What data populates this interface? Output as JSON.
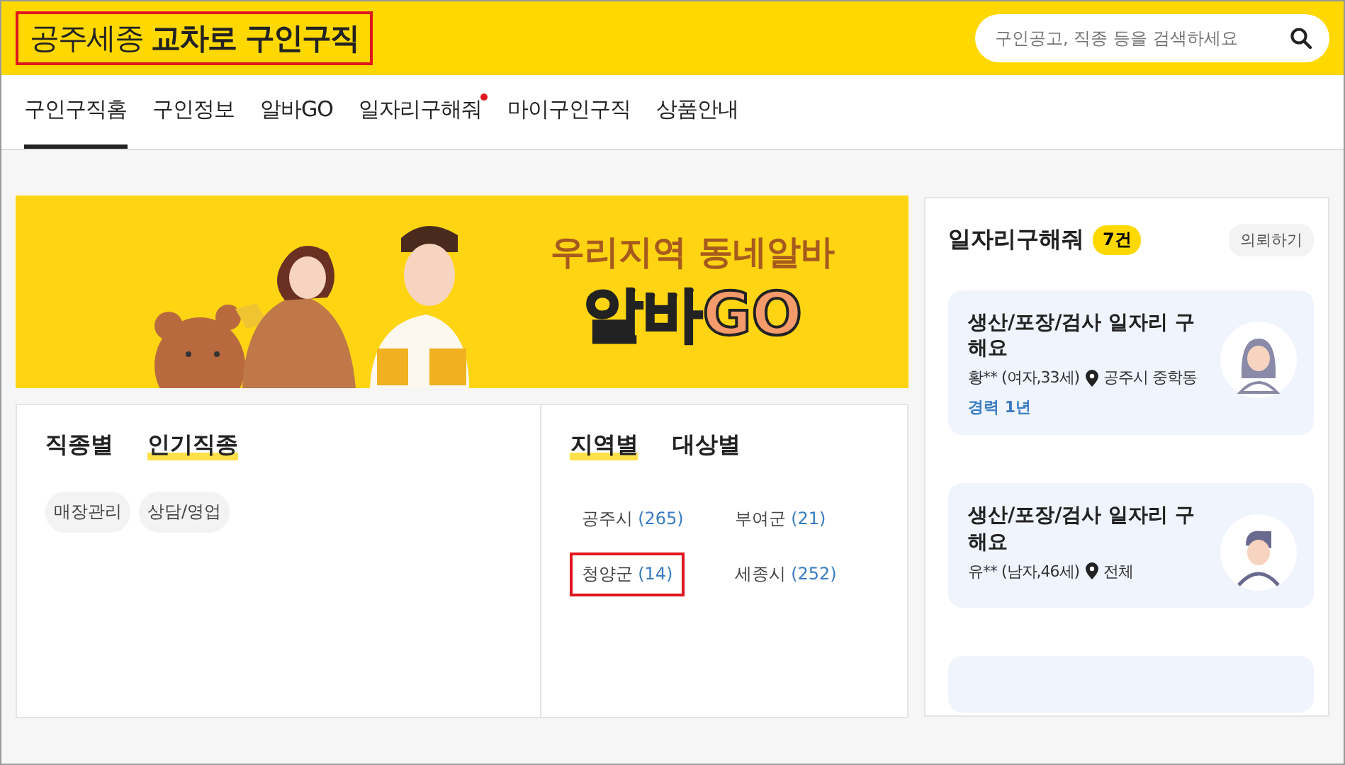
{
  "header": {
    "logo_light": "공주세종",
    "logo_bold": "교차로 구인구직",
    "logo_highlighted": true,
    "search": {
      "placeholder": "구인공고, 직종 등을 검색하세요"
    }
  },
  "nav": [
    {
      "label": "구인구직홈",
      "selected": true,
      "dot": false
    },
    {
      "label": "구인정보",
      "selected": false,
      "dot": false
    },
    {
      "label": "알바GO",
      "selected": false,
      "dot": false
    },
    {
      "label": "일자리구해줘",
      "selected": false,
      "dot": true
    },
    {
      "label": "마이구인구직",
      "selected": false,
      "dot": false
    },
    {
      "label": "상품안내",
      "selected": false,
      "dot": false
    }
  ],
  "banner": {
    "subtitle": "우리지역 동네알바",
    "title_parts": [
      "알바",
      "GO"
    ]
  },
  "job_panel": {
    "tabs": [
      {
        "label": "직종별",
        "selected": false
      },
      {
        "label": "인기직종",
        "selected": true
      }
    ],
    "chips": [
      "매장관리",
      "상담/영업"
    ]
  },
  "region_panel": {
    "tabs": [
      {
        "label": "지역별",
        "selected": true
      },
      {
        "label": "대상별",
        "selected": false
      }
    ],
    "regions": [
      {
        "name": "공주시",
        "count": "(265)",
        "highlighted": false
      },
      {
        "name": "부여군",
        "count": "(21)",
        "highlighted": false
      },
      {
        "name": "청양군",
        "count": "(14)",
        "highlighted": true
      },
      {
        "name": "세종시",
        "count": "(252)",
        "highlighted": false
      }
    ]
  },
  "requests": {
    "title": "일자리구해줘",
    "badge": "7건",
    "button": "의뢰하기",
    "cards": [
      {
        "title": "생산/포장/검사 일자리 구해요",
        "person": "황** (여자,33세)",
        "location": "공주시 중학동",
        "experience": "경력 1년",
        "kind": "female"
      },
      {
        "title": "생산/포장/검사 일자리 구해요",
        "person": "유** (남자,46세)",
        "location": "전체",
        "kind": "male"
      }
    ],
    "more_cards": true
  }
}
